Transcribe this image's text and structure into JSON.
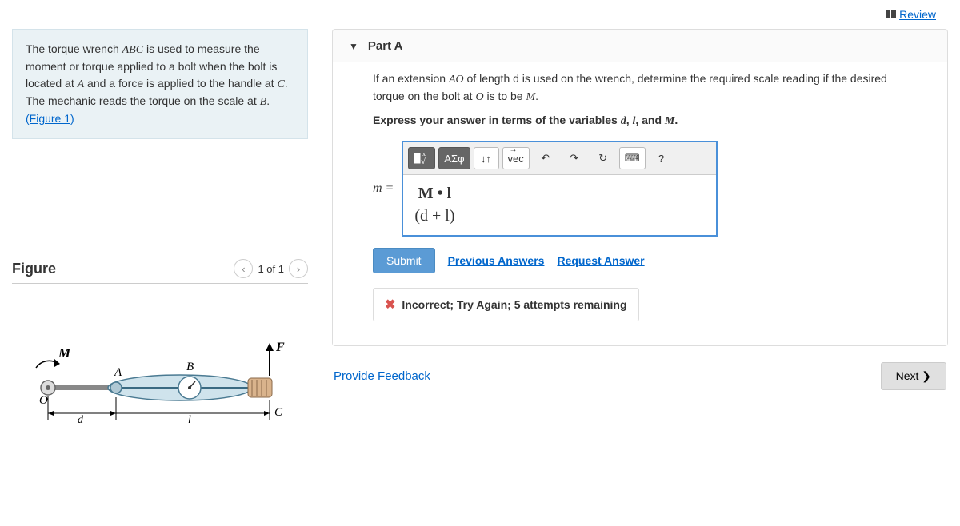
{
  "topbar": {
    "review": "Review"
  },
  "problem": {
    "text_pre": "The torque wrench ",
    "abc": "ABC",
    "text_mid1": " is used to measure the moment or torque applied to a bolt when the bolt is located at ",
    "a": "A",
    "text_mid2": " and a force is applied to the handle at ",
    "c": "C",
    "text_mid3": ". The mechanic reads the torque on the scale at ",
    "b": "B",
    "text_end": ".",
    "figure_link": "(Figure 1)"
  },
  "figure": {
    "title": "Figure",
    "counter": "1 of 1",
    "labels": {
      "M": "M",
      "A": "A",
      "B": "B",
      "F": "F",
      "O": "O",
      "C": "C",
      "d": "d",
      "l": "l"
    }
  },
  "part": {
    "title": "Part A",
    "q_pre": "If an extension ",
    "ao": "AO",
    "q_mid1": " of length d is used on the wrench, determine the required scale reading if the desired torque on the bolt at ",
    "o": "O",
    "q_mid2": " is to be ",
    "m": "M",
    "q_end": ".",
    "instr_pre": "Express your answer in terms of the variables ",
    "iv1": "d",
    "comma1": ", ",
    "iv2": "l",
    "comma2": ", and ",
    "iv3": "M",
    "instr_end": ".",
    "meq": "m =",
    "answer": {
      "num": "M • l",
      "den": "(d + l)"
    },
    "toolbar": {
      "templates": "√",
      "greek": "ΑΣφ",
      "subsup": "↓↑",
      "vec_label": "vec",
      "undo": "↶",
      "redo": "↷",
      "reset": "↻",
      "keyboard": "⌨",
      "help": "?"
    },
    "submit": "Submit",
    "prev_answers": "Previous Answers",
    "request_answer": "Request Answer",
    "feedback": "Incorrect; Try Again; 5 attempts remaining"
  },
  "footer": {
    "provide_feedback": "Provide Feedback",
    "next": "Next ❯"
  }
}
